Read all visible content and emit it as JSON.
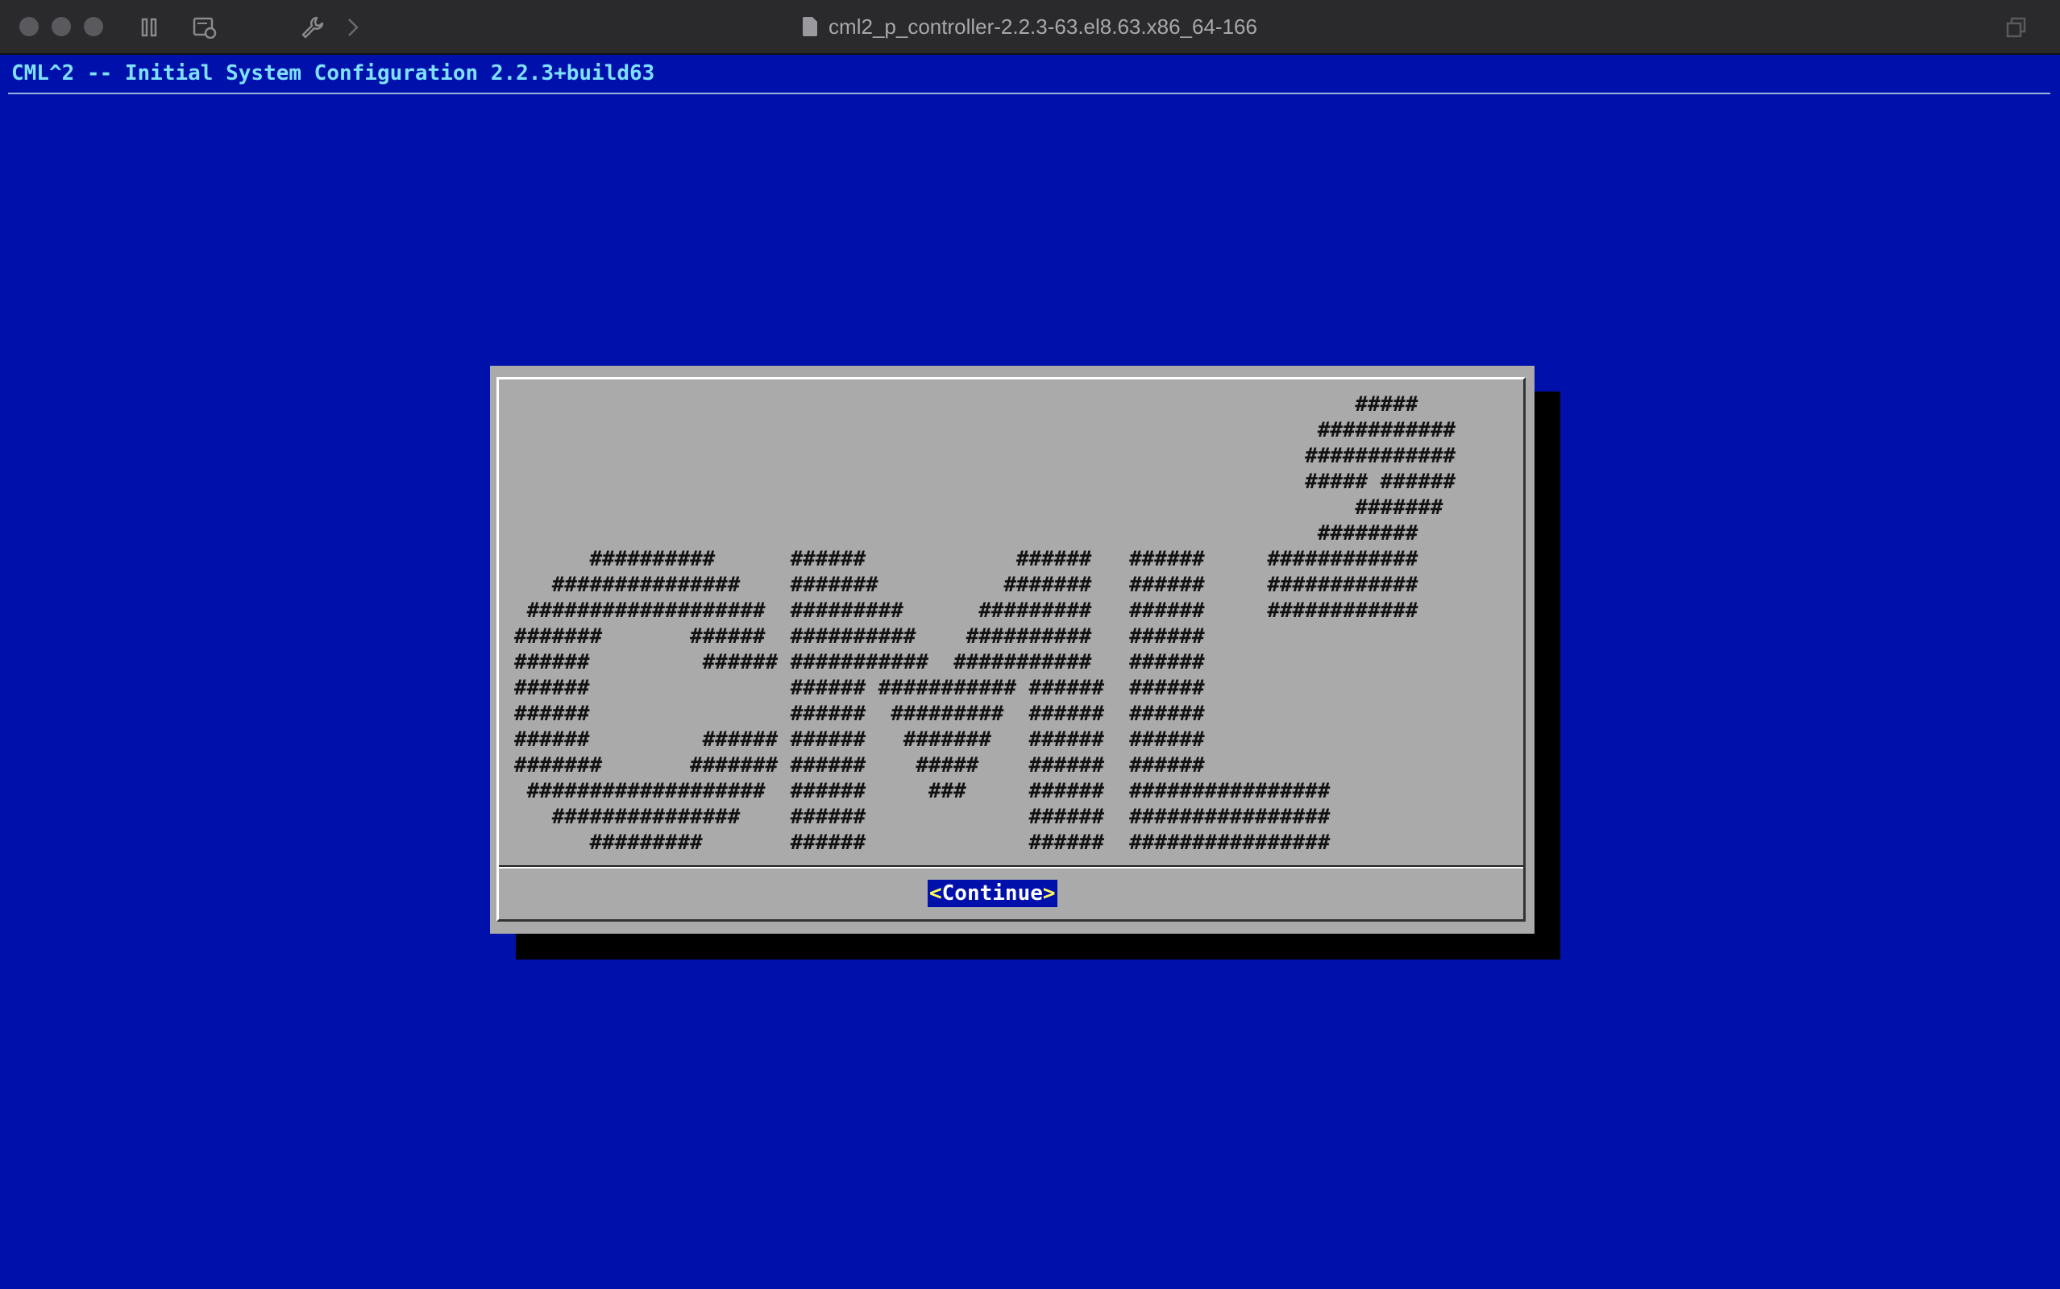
{
  "window": {
    "title": "cml2_p_controller-2.2.3-63.el8.63.x86_64-166",
    "toolbar_icons": [
      "pause-icon",
      "snapshot-icon",
      "wrench-icon",
      "forward-chevron-icon",
      "window-resize-icon"
    ]
  },
  "terminal": {
    "header": "CML^2 -- Initial System Configuration 2.2.3+build63"
  },
  "dialog": {
    "logo_art": "                                                                   #####\n                                                                ###########\n                                                               ############\n                                                               ##### ######\n                                                                   #######\n                                                                ########\n      ##########      ######            ######   ######     ############\n   ###############    #######          #######   ######     ############\n ###################  #########      #########   ######     ############\n#######       ######  ##########    ##########   ######\n######         ###### ###########  ###########   ######\n######                ###### ########### ######  ######\n######                ######  #########  ######  ######\n######         ###### ######   #######   ######  ######\n#######       ####### ######    #####    ######  ######\n ###################  ######     ###     ######  ################\n   ###############    ######             ######  ################\n      #########       ######             ######  ################",
    "button": {
      "hot_left": "<",
      "label": "Continue",
      "hot_right": ">"
    }
  },
  "colors": {
    "background": "#0010aa",
    "header_text": "#7fe0ff",
    "dialog_bg": "#aaaaaa",
    "button_bg": "#0010aa",
    "button_text": "#ffffff"
  }
}
